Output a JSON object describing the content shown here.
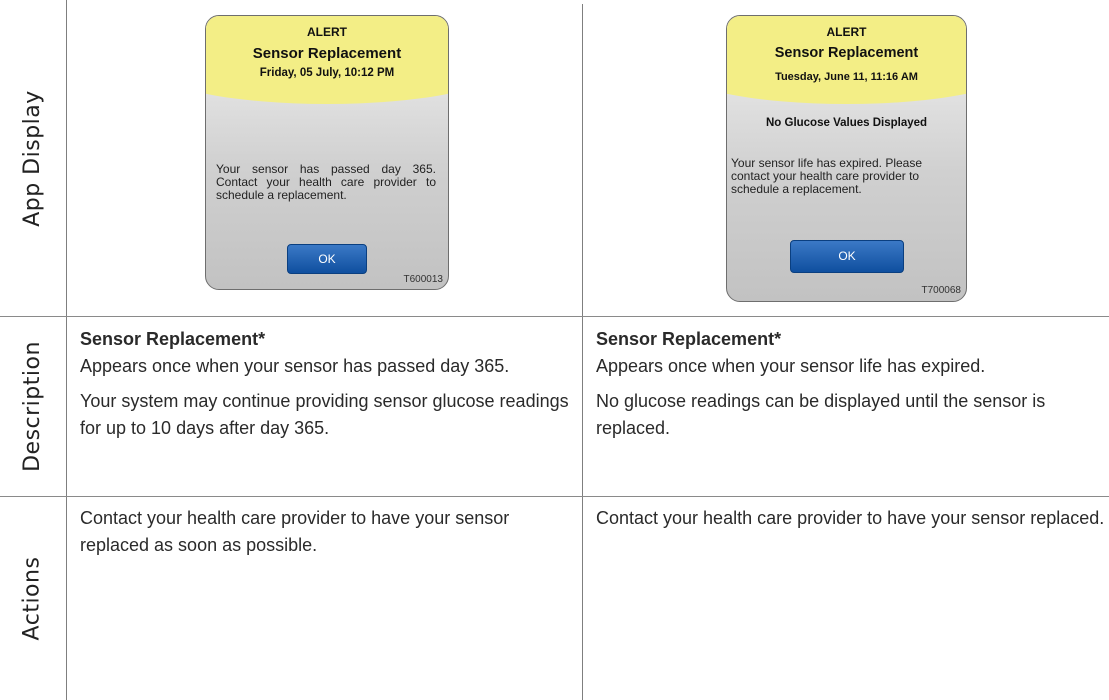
{
  "row_labels": {
    "app_display": "App Display",
    "description": "Description",
    "actions": "Actions"
  },
  "left": {
    "screen": {
      "alert": "ALERT",
      "title": "Sensor Replacement",
      "datetime": "Friday, 05 July, 10:12 PM",
      "body": "Your sensor has passed day 365. Contact your health care provider to schedule a replacement.",
      "ok": "OK",
      "code": "T600013"
    },
    "description": {
      "heading": "Sensor Replacement*",
      "para1": "Appears once when your sensor has passed day 365.",
      "para2": "Your system may continue providing sensor glucose readings for up to 10 days after day 365."
    },
    "actions": "Contact your health care provider to have your sensor replaced as soon as possible."
  },
  "right": {
    "screen": {
      "alert": "ALERT",
      "title": "Sensor Replacement",
      "datetime": "Tuesday, June 11, 11:16 AM",
      "subheading": "No Glucose Values Displayed",
      "body": "Your sensor life has expired. Please contact your health care provider to schedule a replacement.",
      "ok": "OK",
      "code": "T700068"
    },
    "description": {
      "heading": "Sensor Replacement*",
      "para1": "Appears once when your sensor life has expired.",
      "para2": "No glucose readings can be displayed until the sensor is replaced."
    },
    "actions": "Contact your health care provider to have your sensor replaced."
  }
}
